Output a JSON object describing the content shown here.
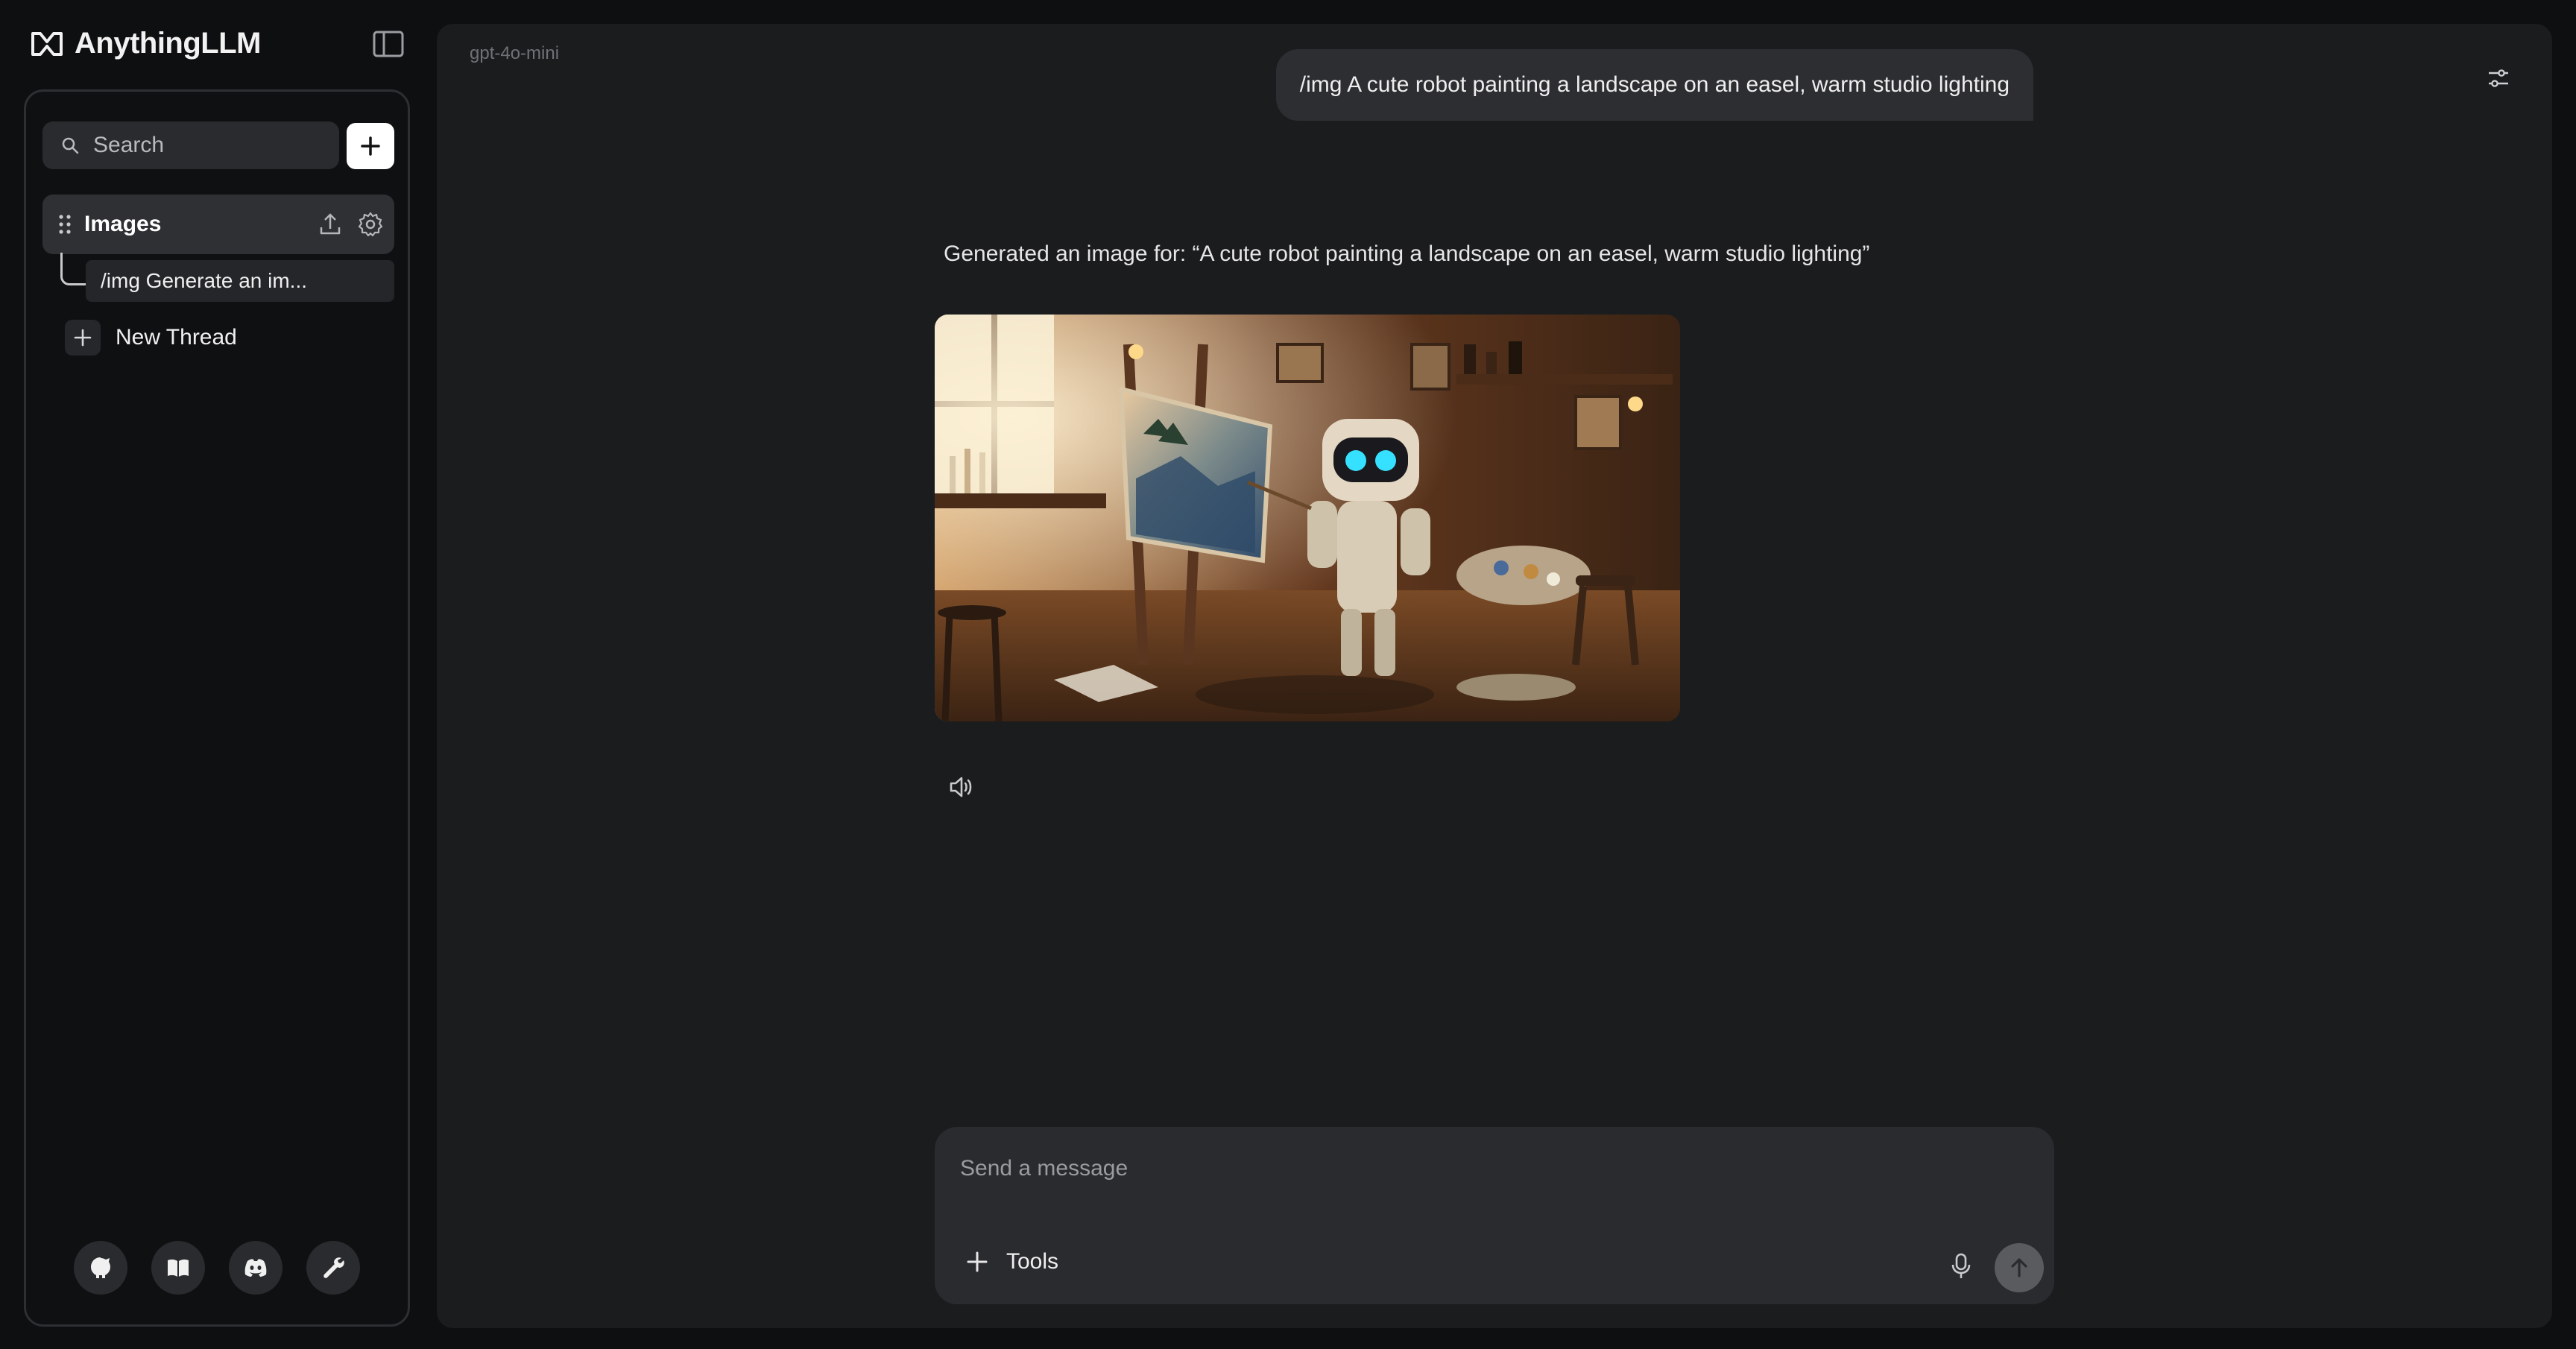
{
  "app": {
    "brand_name": "AnythingLLM"
  },
  "sidebar": {
    "search_label": "Search",
    "workspace": {
      "name": "Images"
    },
    "thread": {
      "title": "/img Generate an im..."
    },
    "new_thread_label": "New Thread",
    "footer_icons": [
      "github-icon",
      "docs-book-icon",
      "discord-icon",
      "wrench-icon"
    ]
  },
  "main": {
    "model_name": "gpt-4o-mini",
    "user_message": "/img A cute robot painting a landscape on an easel, warm studio lighting",
    "assistant_message": "Generated an image for: “A cute robot painting a landscape on an easel, warm studio lighting”"
  },
  "composer": {
    "placeholder": "Send a message",
    "tools_label": "Tools"
  },
  "colors": {
    "background": "#0e0f10",
    "panel": "#1b1c1e",
    "bubble": "#2d2e32",
    "accent_white": "#ffffff"
  }
}
